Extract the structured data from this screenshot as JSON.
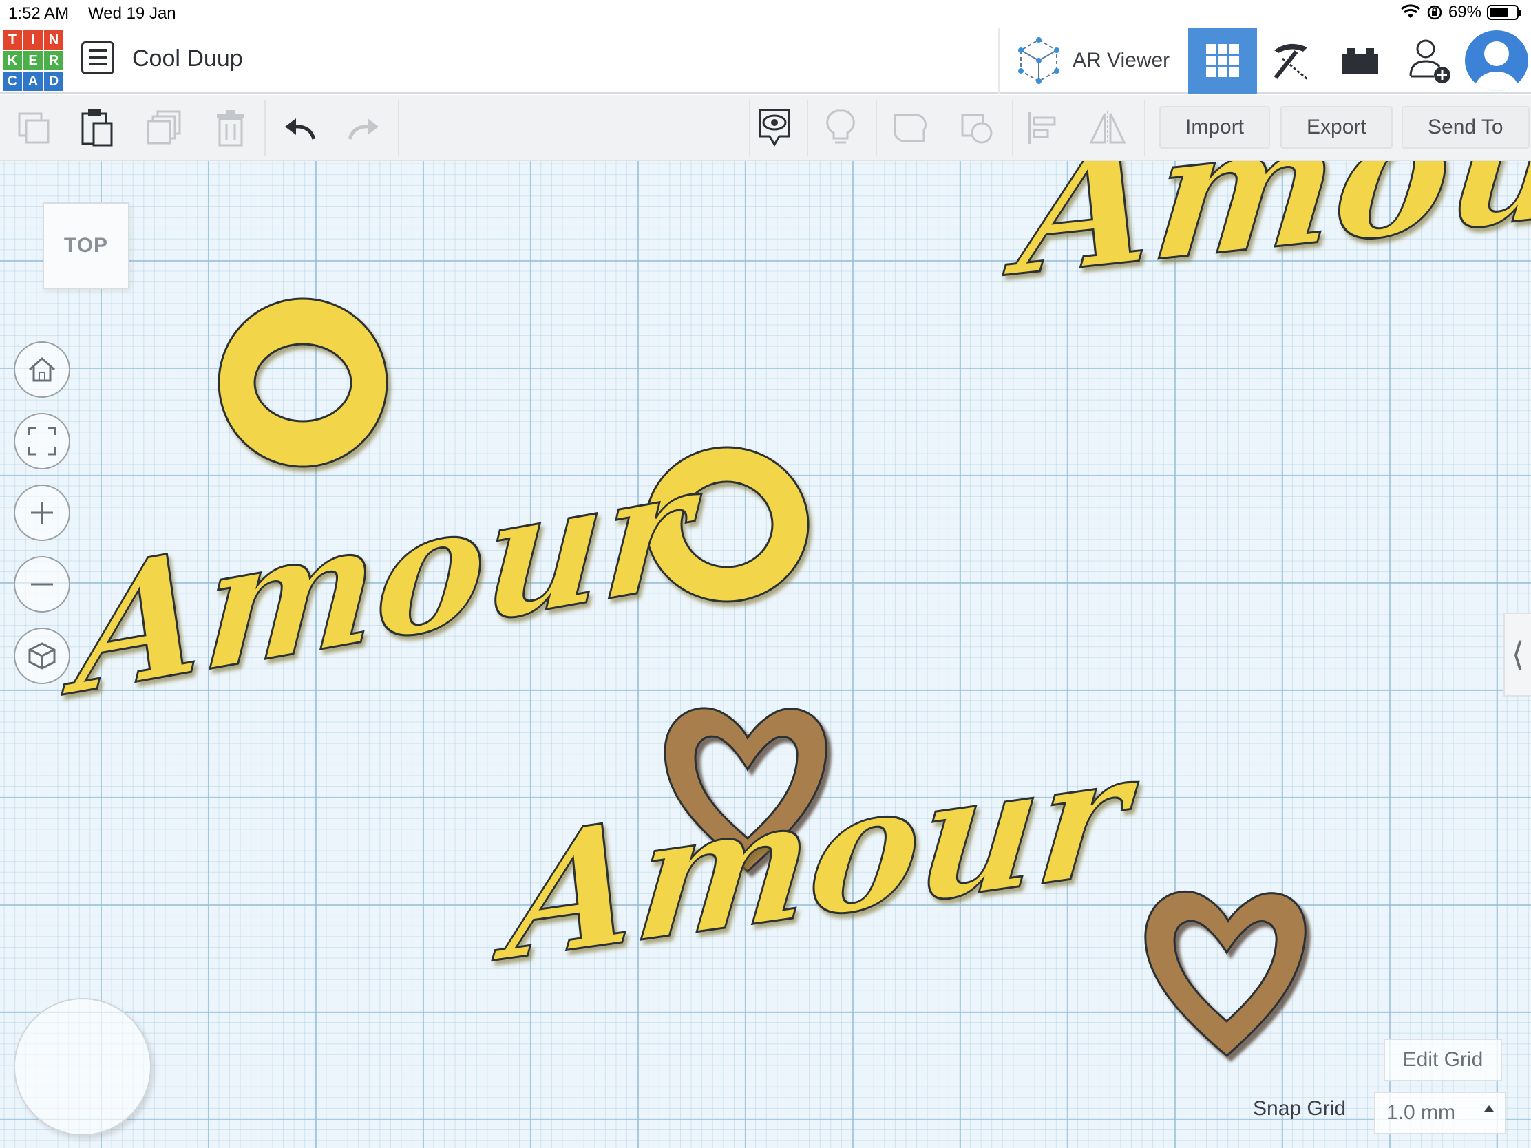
{
  "status_bar": {
    "time": "1:52 AM",
    "date": "Wed 19 Jan",
    "battery": "69%",
    "battery_level": 0.69
  },
  "header": {
    "logo_letters": [
      "T",
      "I",
      "N",
      "K",
      "E",
      "R",
      "C",
      "A",
      "D"
    ],
    "logo_colors": [
      "#e2452c",
      "#e2452c",
      "#e2452c",
      "#4cb04a",
      "#4cb04a",
      "#4cb04a",
      "#2f77c9",
      "#2f77c9",
      "#2f77c9"
    ],
    "design_title": "Cool Duup",
    "ar_viewer_label": "AR Viewer",
    "view_modes": [
      "3d-design-icon",
      "codeblocks-pickaxe-icon",
      "bricks-icon"
    ],
    "active_view": "3d-design-icon"
  },
  "toolbar": {
    "left_tools": [
      "copy-icon",
      "paste-icon",
      "duplicate-icon",
      "delete-icon",
      "undo-icon",
      "redo-icon"
    ],
    "right_tools": [
      "notes-visibility-icon",
      "show-all-icon",
      "group-icon",
      "ungroup-icon",
      "align-icon",
      "mirror-icon"
    ],
    "import_label": "Import",
    "export_label": "Export",
    "send_to_label": "Send To"
  },
  "workplane": {
    "view_cube_label": "TOP",
    "nav_buttons": [
      "home-view-icon",
      "fit-all-icon",
      "zoom-in-icon",
      "zoom-out-icon",
      "perspective-toggle-icon"
    ],
    "edit_grid_label": "Edit Grid",
    "snap_grid_label": "Snap Grid",
    "snap_grid_value": "1.0 mm",
    "panel_toggle_glyph": "⟨"
  },
  "scene": {
    "text_shape": "Amour",
    "colors": {
      "gold": "#f2d54a",
      "gold_dark": "#b89a1d",
      "brown": "#a87e4e",
      "brown_dark": "#6f5231",
      "outline": "#2c3036",
      "accent_blue": "#4a8fd8"
    }
  }
}
